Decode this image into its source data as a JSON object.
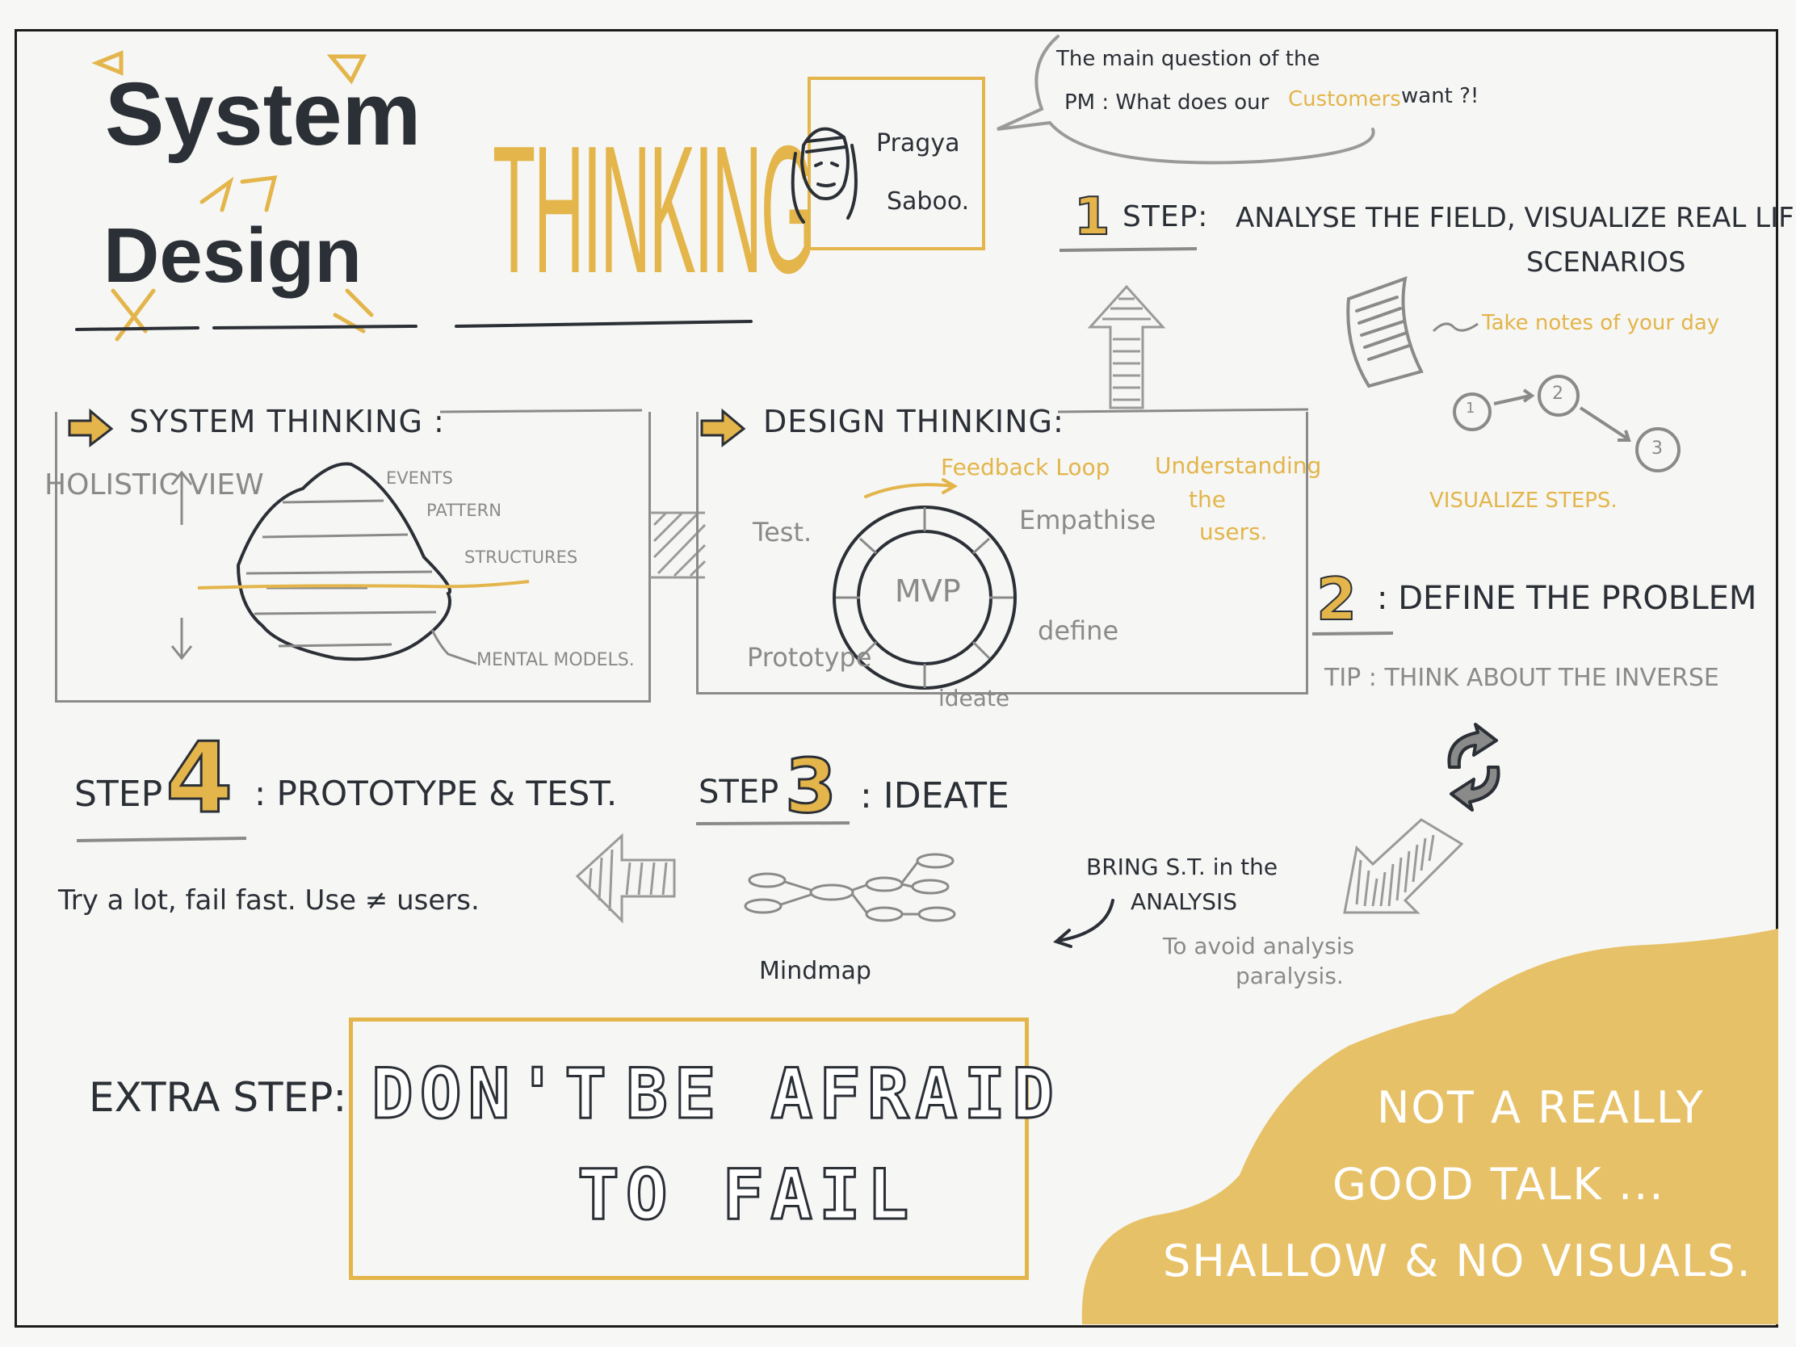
{
  "title": {
    "line1": "System",
    "line2": "Design",
    "word": "THINKING"
  },
  "speaker": {
    "first": "Pragya",
    "last": "Saboo."
  },
  "question": {
    "line1": "The main question of the",
    "line2_a": "PM : What does our",
    "line2_b": "Customers",
    "line2_c": "want ?!"
  },
  "step1": {
    "num": "1",
    "label": "STEP:",
    "text1": "ANALYSE THE FIELD, VISUALIZE REAL LIFE",
    "text2": "SCENARIOS",
    "notes": "Take notes of your day",
    "visualize": "VISUALIZE STEPS.",
    "nodes": [
      "1",
      "2",
      "3"
    ]
  },
  "system_thinking": {
    "heading": "SYSTEM THINKING :",
    "holistic": "HOLISTIC VIEW",
    "layers": [
      "EVENTS",
      "PATTERN",
      "STRUCTURES",
      "MENTAL MODELS."
    ]
  },
  "design_thinking": {
    "heading": "DESIGN THINKING:",
    "feedback": "Feedback Loop",
    "understanding": [
      "Understanding",
      "the",
      "users."
    ],
    "center": "MVP",
    "phases": {
      "test": "Test.",
      "empathise": "Empathise",
      "define": "define",
      "ideate": "ideate",
      "prototype": "Prototype"
    }
  },
  "step2": {
    "num": "2",
    "label": ": DEFINE THE PROBLEM",
    "tip": "TIP : THINK ABOUT THE INVERSE"
  },
  "step3": {
    "prefix": "STEP",
    "num": "3",
    "label": ": IDEATE",
    "mindmap": "Mindmap"
  },
  "step4": {
    "prefix": "STEP",
    "num": "4",
    "label": ": PROTOTYPE & TEST.",
    "text": "Try a lot, fail fast. Use ≠ users."
  },
  "bring": {
    "line1": "BRING S.T. in the",
    "line2": "ANALYSIS",
    "note1": "To avoid analysis",
    "note2": "paralysis."
  },
  "extra": {
    "label": "EXTRA STEP:",
    "line1a": "DON'T",
    "line1b": "BE AFRAID",
    "line2": "TO FAIL"
  },
  "verdict": {
    "line1": "NOT A REALLY",
    "line2": "GOOD TALK ...",
    "line3": "SHALLOW & NO VISUALS."
  },
  "colors": {
    "accent": "#e3b54a",
    "ink": "#2b2f36",
    "pencil": "#8a8a8a",
    "paper": "#f6f6f4"
  }
}
